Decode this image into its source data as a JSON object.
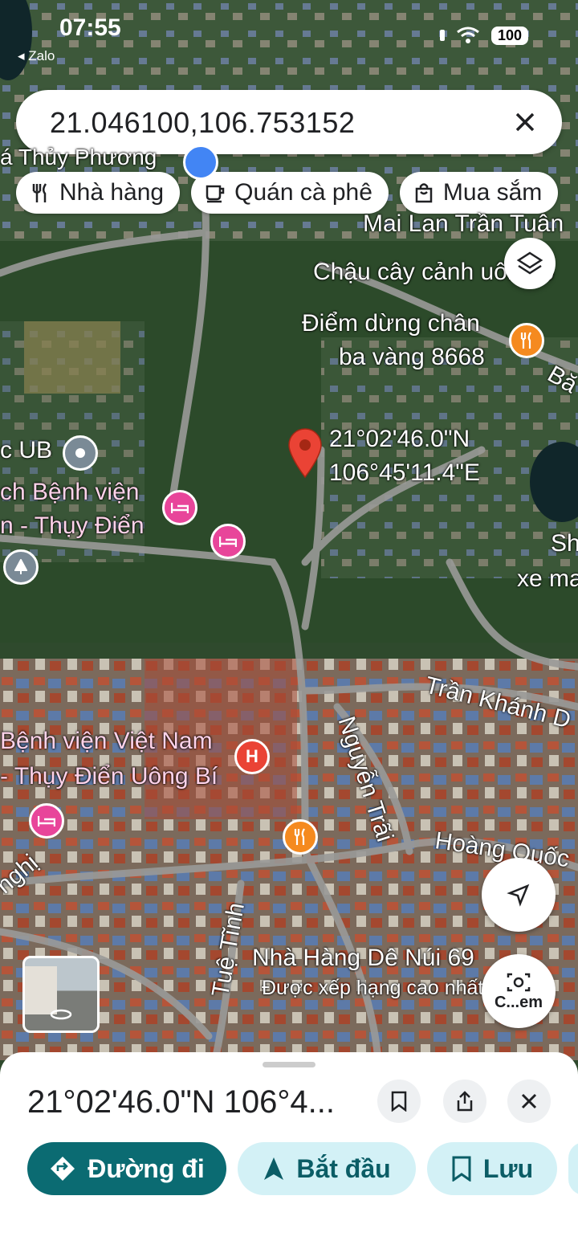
{
  "status_bar": {
    "time": "07:55",
    "back_app": "Zalo",
    "battery": "100"
  },
  "search": {
    "query": "21.046100,106.753152"
  },
  "chips": [
    {
      "label": "Nhà hàng",
      "icon": "fork-knife-icon"
    },
    {
      "label": "Quán cà phê",
      "icon": "coffee-icon"
    },
    {
      "label": "Mua sắm",
      "icon": "shopping-bag-icon"
    }
  ],
  "map_labels": {
    "thuy_phuong": "á Thủy Phương",
    "mai_lan": "Mai Lan Trần Tuân",
    "chau_cay": "Chậu cây cảnh uông b",
    "diem_dung_1": "Điểm dừng chân",
    "diem_dung_2": "ba vàng 8668",
    "ba": "Bă",
    "pin_lat": "21°02'46.0\"N",
    "pin_lng": "106°45'11.4\"E",
    "ub": "c UB",
    "benh_vien_small_1": "ch Bệnh viện",
    "benh_vien_small_2": "n - Thụy Điển",
    "sh": "Sh",
    "xema": "xe ma",
    "tran_khanh_du": "Trần Khánh D",
    "benh_vien_1": "Bệnh viện Việt Nam",
    "benh_vien_2": "- Thụy Điển Uông Bí",
    "nguyen_trai": "Nguyễn Trãi",
    "hoang_quoc": "Hoàng Quốc",
    "nghi": "nghị",
    "tue_tinh": "Tuệ Tĩnh",
    "nha_hang_de": "Nhà Hàng Dê Núi 69",
    "xep_hang": "Được xếp hạng cao nhất"
  },
  "camera_button": {
    "label": "C...em"
  },
  "sheet": {
    "title": "21°02'46.0\"N 106°4...",
    "actions": [
      {
        "label": "Đường đi"
      },
      {
        "label": "Bắt đầu"
      },
      {
        "label": "Lưu"
      }
    ]
  },
  "colors": {
    "accent": "#0b6b72",
    "secondary": "#d3f1f6",
    "pin": "#ea4335",
    "hotel": "#e8459a",
    "food": "#f58a1f"
  }
}
